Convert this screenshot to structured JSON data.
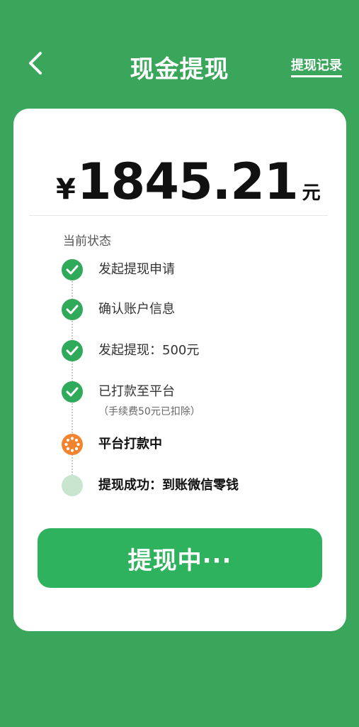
{
  "header": {
    "title": "现金提现",
    "records_link": "提现记录"
  },
  "amount": {
    "currency_symbol": "¥",
    "value": "1845.21",
    "unit": "元"
  },
  "status": {
    "label": "当前状态",
    "steps": [
      {
        "text": "发起提现申请",
        "state": "done"
      },
      {
        "text": "确认账户信息",
        "state": "done"
      },
      {
        "text": "发起提现：500元",
        "state": "done"
      },
      {
        "text": "已打款至平台",
        "note": "（手续费50元已扣除）",
        "state": "done"
      },
      {
        "text": "平台打款中",
        "state": "active"
      },
      {
        "text": "提现成功：到账微信零钱",
        "state": "pending"
      }
    ]
  },
  "action_button": {
    "label": "提现中···"
  },
  "colors": {
    "background": "#3aa65c",
    "done": "#2fa95a",
    "active": "#f2832f",
    "pending": "#c9e5d0",
    "button": "#2fb25e"
  }
}
